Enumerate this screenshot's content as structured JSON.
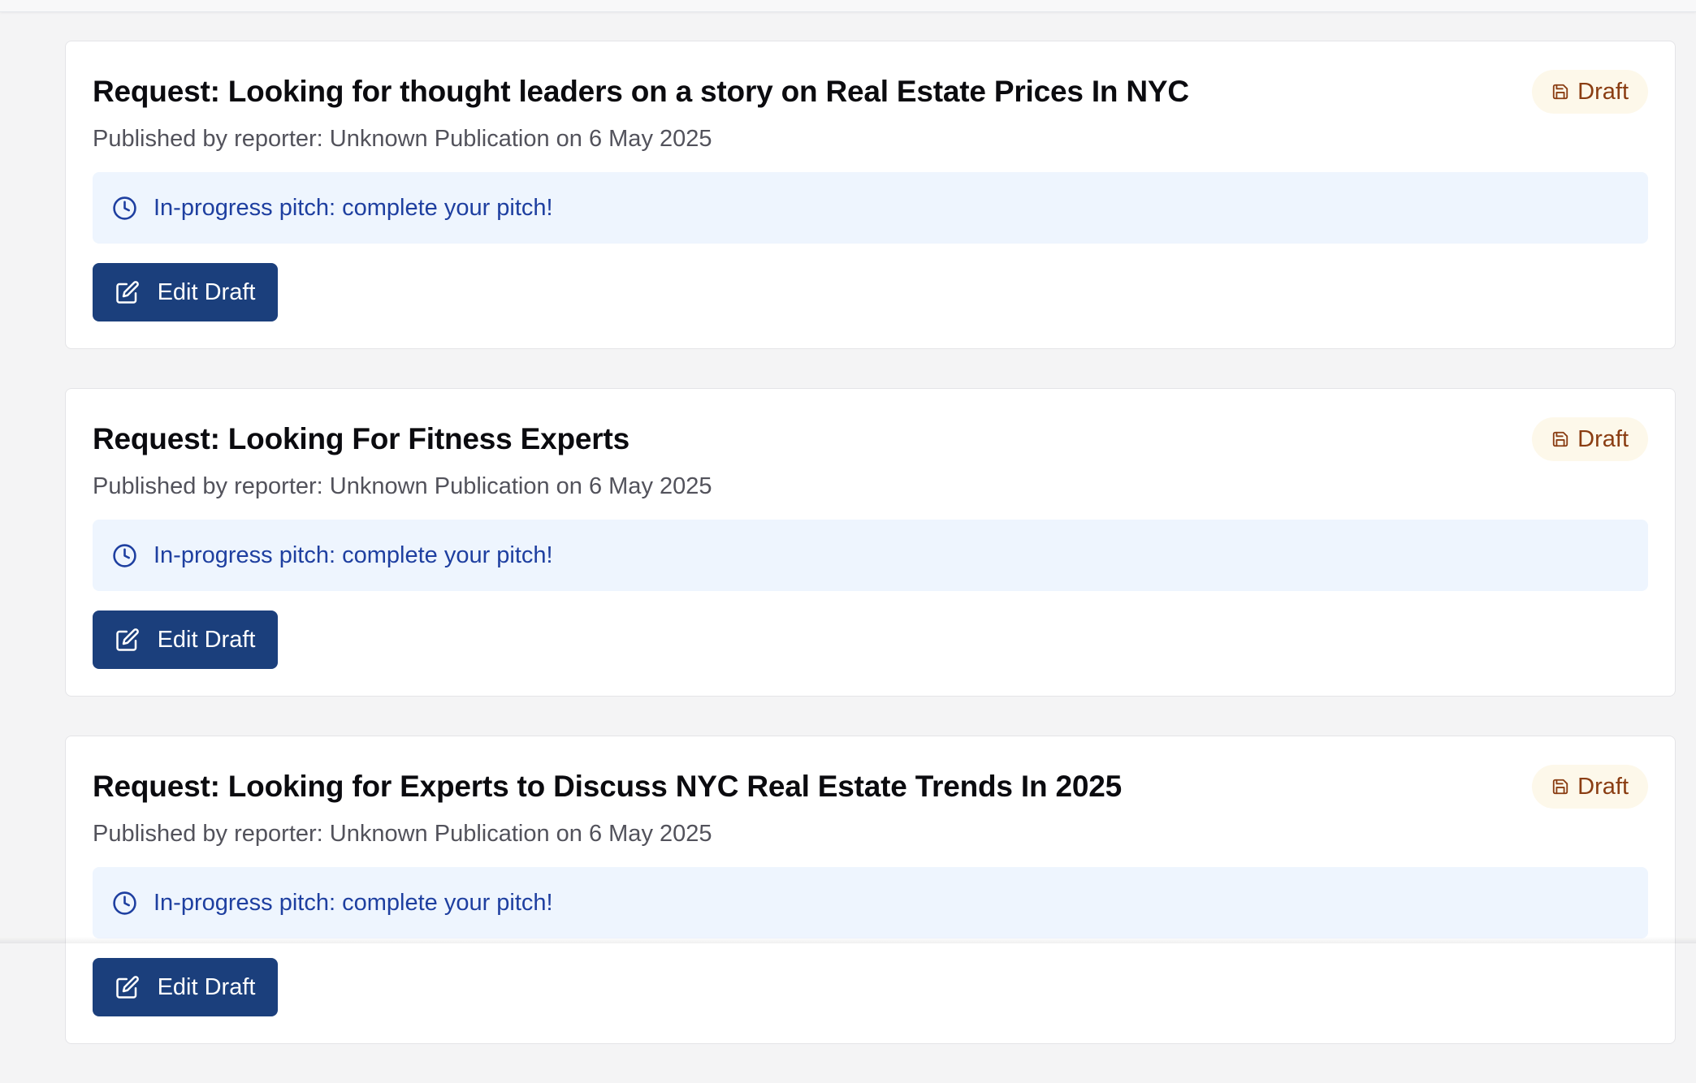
{
  "cards": [
    {
      "title": "Request: Looking for thought leaders on a story on Real Estate Prices In NYC",
      "meta": "Published by reporter: Unknown Publication on 6 May 2025",
      "badge": "Draft",
      "notice": "In-progress pitch: complete your pitch!",
      "button": "Edit Draft"
    },
    {
      "title": "Request: Looking For Fitness Experts",
      "meta": "Published by reporter: Unknown Publication on 6 May 2025",
      "badge": "Draft",
      "notice": "In-progress pitch: complete your pitch!",
      "button": "Edit Draft"
    },
    {
      "title": "Request: Looking for Experts to Discuss NYC Real Estate Trends In 2025",
      "meta": "Published by reporter: Unknown Publication on 6 May 2025",
      "badge": "Draft",
      "notice": "In-progress pitch: complete your pitch!",
      "button": "Edit Draft"
    }
  ],
  "icons": {
    "badge": "save-icon",
    "notice": "clock-icon",
    "button": "edit-icon"
  },
  "colors": {
    "primary_button": "#1b3f7c",
    "notice_bg": "#eef5fe",
    "notice_text": "#1e3fa0",
    "badge_bg": "#fdf8ea",
    "badge_text": "#8a3d12"
  }
}
